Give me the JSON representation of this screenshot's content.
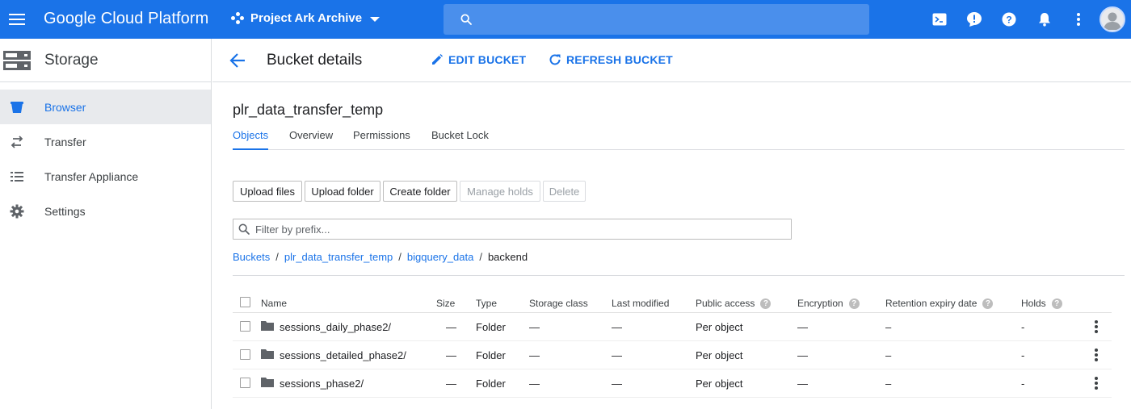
{
  "topbar": {
    "brand": "Google Cloud Platform",
    "project": "Project Ark Archive",
    "search_placeholder": "",
    "icons": [
      "menu-icon",
      "project-icon",
      "search-icon",
      "terminal-icon",
      "notification-alert-icon",
      "help-icon",
      "bell-icon",
      "more-vert-icon",
      "avatar"
    ]
  },
  "sidebar": {
    "title": "Storage",
    "items": [
      {
        "label": "Browser",
        "icon": "bucket-icon",
        "active": true
      },
      {
        "label": "Transfer",
        "icon": "transfer-icon",
        "active": false
      },
      {
        "label": "Transfer Appliance",
        "icon": "list-icon",
        "active": false
      },
      {
        "label": "Settings",
        "icon": "gear-icon",
        "active": false
      }
    ]
  },
  "header": {
    "title": "Bucket details",
    "edit_label": "EDIT BUCKET",
    "refresh_label": "REFRESH BUCKET"
  },
  "bucket": {
    "name": "plr_data_transfer_temp",
    "tabs": [
      "Objects",
      "Overview",
      "Permissions",
      "Bucket Lock"
    ],
    "active_tab": "Objects"
  },
  "toolbar": {
    "upload_files": "Upload files",
    "upload_folder": "Upload folder",
    "create_folder": "Create folder",
    "manage_holds": "Manage holds",
    "delete": "Delete"
  },
  "filter": {
    "placeholder": "Filter by prefix..."
  },
  "breadcrumb": {
    "items": [
      "Buckets",
      "plr_data_transfer_temp",
      "bigquery_data",
      "backend"
    ],
    "separator": "/"
  },
  "table": {
    "columns": [
      "Name",
      "Size",
      "Type",
      "Storage class",
      "Last modified",
      "Public access",
      "Encryption",
      "Retention expiry date",
      "Holds"
    ],
    "rows": [
      {
        "name": "sessions_daily_phase2/",
        "size": "—",
        "type": "Folder",
        "storage_class": "—",
        "last_modified": "—",
        "public_access": "Per object",
        "encryption": "—",
        "retention": "–",
        "holds": "-"
      },
      {
        "name": "sessions_detailed_phase2/",
        "size": "—",
        "type": "Folder",
        "storage_class": "—",
        "last_modified": "—",
        "public_access": "Per object",
        "encryption": "—",
        "retention": "–",
        "holds": "-"
      },
      {
        "name": "sessions_phase2/",
        "size": "—",
        "type": "Folder",
        "storage_class": "—",
        "last_modified": "—",
        "public_access": "Per object",
        "encryption": "—",
        "retention": "–",
        "holds": "-"
      }
    ]
  },
  "colors": {
    "topbar": "#1a73e8",
    "accent": "#1a73e8",
    "sidebar_active_bg": "#e8eaed"
  }
}
